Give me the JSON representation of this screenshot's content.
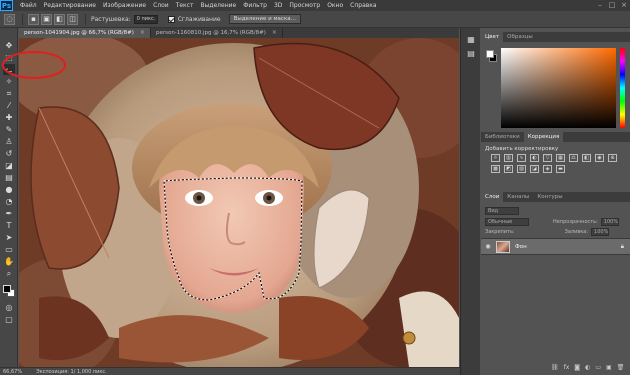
{
  "menubar": {
    "logo": "Ps",
    "items": [
      "Файл",
      "Редактирование",
      "Изображение",
      "Слои",
      "Текст",
      "Выделение",
      "Фильтр",
      "3D",
      "Просмотр",
      "Окно",
      "Справка"
    ],
    "window_controls": [
      "–",
      "□",
      "×"
    ]
  },
  "options": {
    "feather_label": "Растушевка:",
    "feather_value": "0 пикс.",
    "antialias_label": "Сглаживание",
    "refine_button": "Выделение и маска..."
  },
  "tabs": [
    {
      "label": "person-1041904.jpg @ 66,7% (RGB/8#)",
      "close": "×"
    },
    {
      "label": "person-1160810.jpg @ 16,7% (RGB/8#)",
      "close": "×"
    }
  ],
  "status": {
    "zoom": "66,67%",
    "doc": "Экспозиция: 1/ 1,000 пикс."
  },
  "panels": {
    "color_tabs": [
      "Цвет",
      "Образцы"
    ],
    "adjust_tabs": [
      "Библиотеки",
      "Коррекция"
    ],
    "adjust_title": "Добавить корректировку",
    "layers_tabs": [
      "Слои",
      "Каналы",
      "Контуры"
    ],
    "kind_label": "Вид",
    "blend_mode": "Обычные",
    "opacity_label": "Непрозрачность:",
    "opacity_value": "100%",
    "lock_label": "Закрепить:",
    "fill_label": "Заливка:",
    "fill_value": "100%",
    "layer_name": "Фон"
  },
  "colors": {
    "accent": "#31a8ff",
    "selection_red": "#e02020"
  }
}
